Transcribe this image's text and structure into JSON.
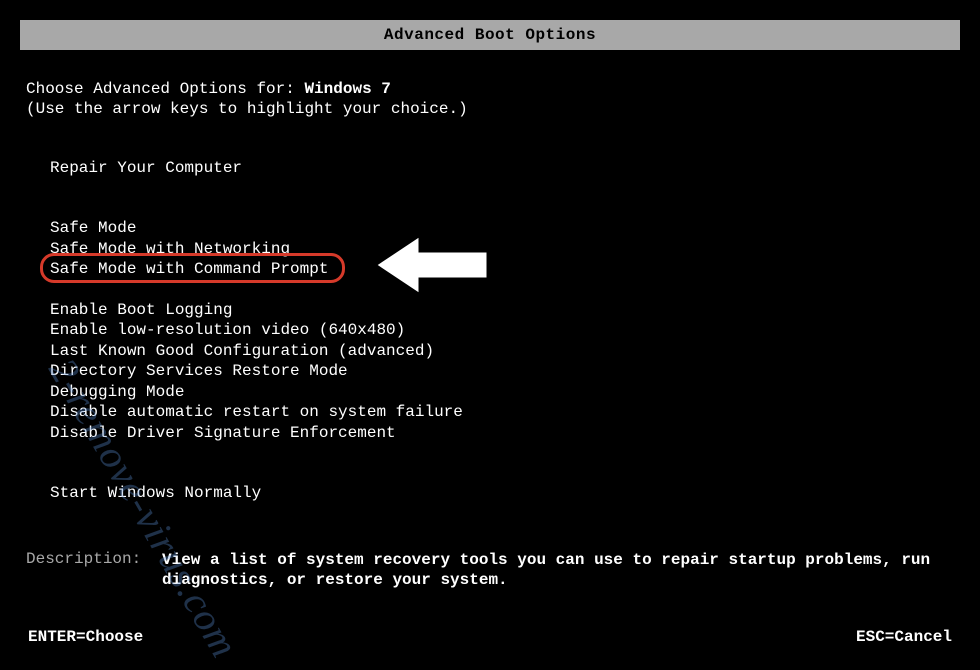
{
  "title": "Advanced Boot Options",
  "intro": {
    "prefix": "Choose Advanced Options for: ",
    "os": "Windows 7",
    "hint": "(Use the arrow keys to highlight your choice.)"
  },
  "menu": {
    "repair": "Repair Your Computer",
    "safe1": "Safe Mode",
    "safe2": "Safe Mode with Networking",
    "safe3": "Safe Mode with Command Prompt",
    "adv1": "Enable Boot Logging",
    "adv2": "Enable low-resolution video (640x480)",
    "adv3": "Last Known Good Configuration (advanced)",
    "adv4": "Directory Services Restore Mode",
    "adv5": "Debugging Mode",
    "adv6": "Disable automatic restart on system failure",
    "adv7": "Disable Driver Signature Enforcement",
    "normal": "Start Windows Normally"
  },
  "description": {
    "label": "Description:",
    "text": "View a list of system recovery tools you can use to repair startup problems, run diagnostics, or restore your system."
  },
  "footer": {
    "enter": "ENTER=Choose",
    "esc": "ESC=Cancel"
  },
  "watermark": "2-remove-virus.com"
}
